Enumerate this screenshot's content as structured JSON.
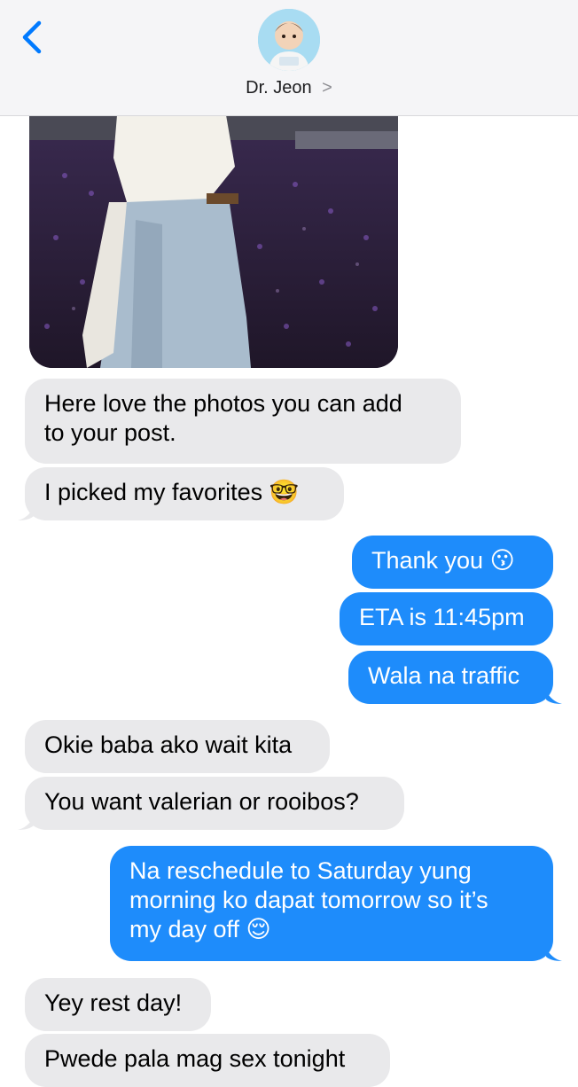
{
  "header": {
    "contact_name": "Dr. Jeon",
    "chevron": ">",
    "back_icon": "chevron-left-icon",
    "accent_color": "#007aff"
  },
  "messages": [
    {
      "side": "in",
      "text_lines": [
        "Here love the photos you can add",
        "to your post."
      ]
    },
    {
      "side": "in",
      "text": "I picked my favorites 🤓"
    },
    {
      "side": "out",
      "text": "Thank you 😗"
    },
    {
      "side": "out",
      "text": "ETA is 11:45pm"
    },
    {
      "side": "out",
      "text": "Wala na traffic"
    },
    {
      "side": "in",
      "text": "Okie baba ako wait kita"
    },
    {
      "side": "in",
      "text": "You want valerian or rooibos?"
    },
    {
      "side": "out",
      "text_lines": [
        "Na reschedule to Saturday yung",
        "morning ko dapat tomorrow so it’s",
        "my day off 😌"
      ]
    },
    {
      "side": "in",
      "text": "Yey rest day!"
    },
    {
      "side": "in",
      "text": "Pwede pala mag sex tonight"
    }
  ],
  "colors": {
    "incoming_bubble": "#e9e9eb",
    "outgoing_bubble": "#1e8cfb",
    "header_bg": "#f5f5f7"
  }
}
